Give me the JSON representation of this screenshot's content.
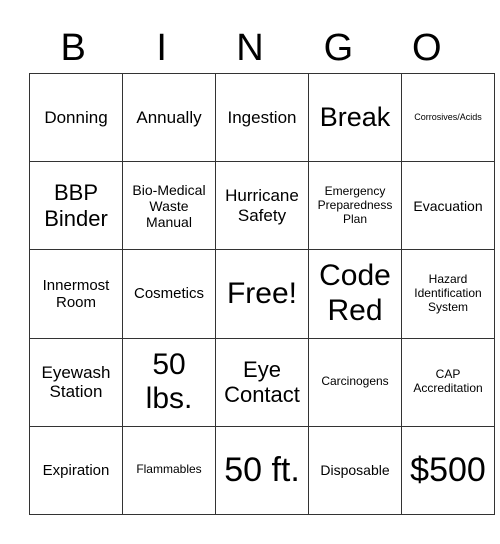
{
  "header": [
    "B",
    "I",
    "N",
    "G",
    "O"
  ],
  "cells": [
    [
      "Donning",
      "Annually",
      "Ingestion",
      "Break",
      "Corrosives/Acids"
    ],
    [
      "BBP Binder",
      "Bio-Medical Waste Manual",
      "Hurricane Safety",
      "Emergency Preparedness Plan",
      "Evacuation"
    ],
    [
      "Innermost Room",
      "Cosmetics",
      "Free!",
      "Code Red",
      "Hazard Identification System"
    ],
    [
      "Eyewash Station",
      "50 lbs.",
      "Eye Contact",
      "Carcinogens",
      "CAP Accreditation"
    ],
    [
      "Expiration",
      "Flammables",
      "50 ft.",
      "Disposable",
      "$500"
    ]
  ]
}
